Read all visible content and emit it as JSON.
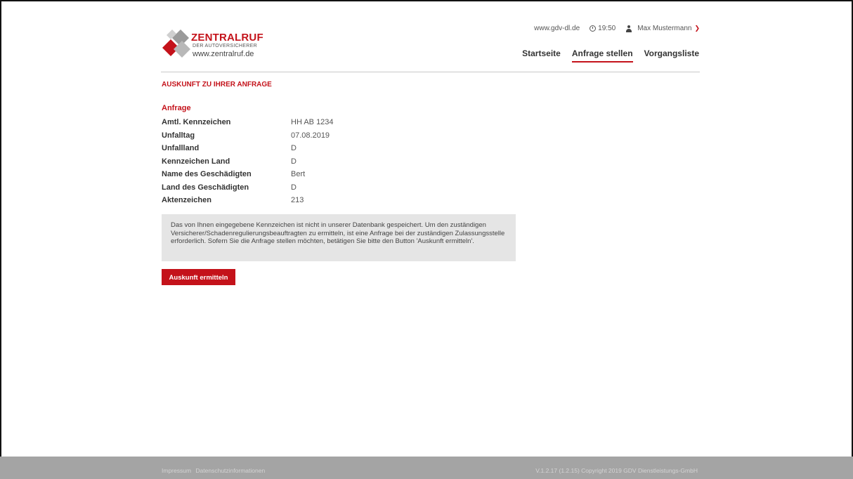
{
  "header": {
    "brand": "ZENTRALRUF",
    "brand_sub": "DER AUTOVERSICHERER",
    "brand_url": "www.zentralruf.de",
    "site_link": "www.gdv-dl.de",
    "time": "19:50",
    "user_name": "Max Mustermann",
    "nav": [
      "Startseite",
      "Anfrage stellen",
      "Vorgangsliste"
    ],
    "active_nav": "Anfrage stellen"
  },
  "page": {
    "section_title": "AUSKUNFT ZU IHRER ANFRAGE",
    "group_title": "Anfrage",
    "fields": [
      {
        "label": "Amtl. Kennzeichen",
        "value": "HH AB 1234"
      },
      {
        "label": "Unfalltag",
        "value": "07.08.2019"
      },
      {
        "label": "Unfallland",
        "value": "D"
      },
      {
        "label": "Kennzeichen Land",
        "value": "D"
      },
      {
        "label": "Name des Geschädigten",
        "value": "Bert"
      },
      {
        "label": "Land des Geschädigten",
        "value": "D"
      },
      {
        "label": "Aktenzeichen",
        "value": "213"
      }
    ],
    "notice": "Das von Ihnen eingegebene Kennzeichen ist nicht in unserer Datenbank gespeichert. Um den zuständigen Versicherer/Schadenregulierungsbeauftragten zu ermitteln, ist eine Anfrage bei der zuständigen Zulassungsstelle erforderlich. Sofern Sie die Anfrage stellen möchten, betätigen Sie bitte den Button 'Auskunft ermitteln'.",
    "button_label": "Auskunft ermitteln"
  },
  "footer": {
    "impressum": "Impressum",
    "datenschutz": "Datenschutzinformationen",
    "version": "V.1.2.17 (1.2.15)",
    "copyright": "Copyright 2019 GDV Dienstleistungs-GmbH"
  },
  "colors": {
    "accent": "#c4121a",
    "footer_bg": "#a4a4a4",
    "notice_bg": "#e5e5e5"
  }
}
